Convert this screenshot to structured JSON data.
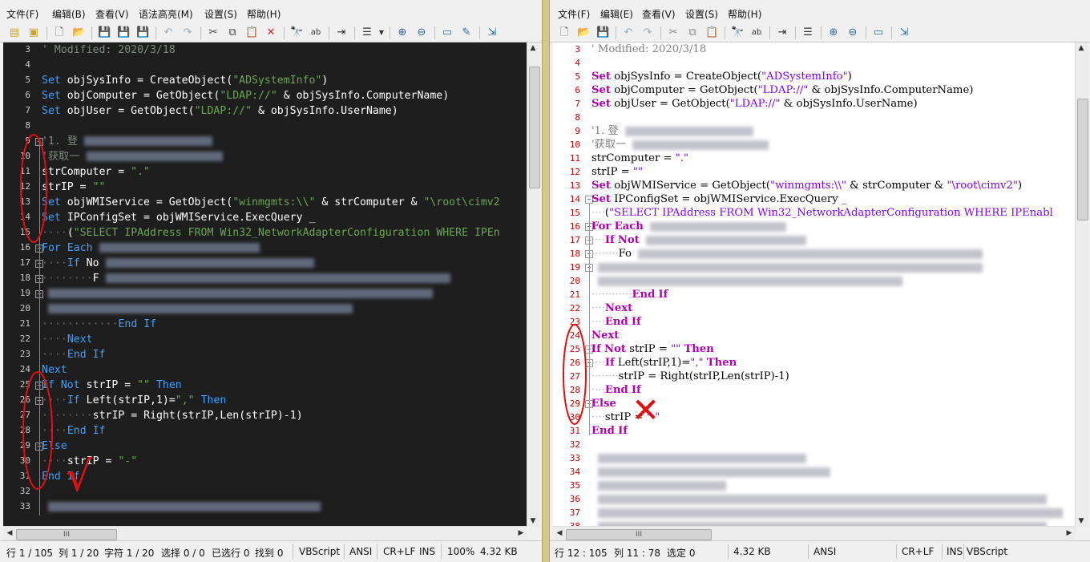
{
  "left": {
    "menu": [
      "文件(F)",
      "编辑(B)",
      "查看(V)",
      "语法高亮(M)",
      "设置(S)",
      "帮助(H)"
    ],
    "lines": [
      {
        "n": "3",
        "t": "' Modified: 2020/3/18"
      },
      {
        "n": "4",
        "t": ""
      },
      {
        "n": "5",
        "t": "Set objSysInfo = CreateObject(\"ADSystemInfo\")"
      },
      {
        "n": "6",
        "t": "Set objComputer = GetObject(\"LDAP://\" & objSysInfo.ComputerName)"
      },
      {
        "n": "7",
        "t": "Set objUser = GetObject(\"LDAP://\" & objSysInfo.UserName)"
      },
      {
        "n": "8",
        "t": ""
      },
      {
        "n": "9",
        "t": "'1. 登"
      },
      {
        "n": "10",
        "t": "'获取一"
      },
      {
        "n": "11",
        "t": "strComputer = \".\""
      },
      {
        "n": "12",
        "t": "strIP = \"\""
      },
      {
        "n": "13",
        "t": "Set objWMIService = GetObject(\"winmgmts:\\\\\" & strComputer & \"\\root\\cimv2"
      },
      {
        "n": "14",
        "t": "Set IPConfigSet = objWMIService.ExecQuery _"
      },
      {
        "n": "15",
        "t": "    (\"SELECT IPAddress FROM Win32_NetworkAdapterConfiguration WHERE IPEn"
      },
      {
        "n": "16",
        "t": "For Each"
      },
      {
        "n": "17",
        "t": "    If No"
      },
      {
        "n": "18",
        "t": "        F"
      },
      {
        "n": "19",
        "t": ""
      },
      {
        "n": "20",
        "t": ""
      },
      {
        "n": "21",
        "t": "            End If"
      },
      {
        "n": "22",
        "t": "    Next"
      },
      {
        "n": "23",
        "t": "    End If"
      },
      {
        "n": "24",
        "t": "Next"
      },
      {
        "n": "25",
        "t": "If Not strIP = \"\" Then"
      },
      {
        "n": "26",
        "t": "    If Left(strIP,1)=\",\" Then"
      },
      {
        "n": "27",
        "t": "        strIP = Right(strIP,Len(strIP)-1)"
      },
      {
        "n": "28",
        "t": "    End If"
      },
      {
        "n": "29",
        "t": "Else"
      },
      {
        "n": "30",
        "t": "    strIP = \"-\""
      },
      {
        "n": "31",
        "t": "End If"
      },
      {
        "n": "32",
        "t": ""
      },
      {
        "n": "33",
        "t": ""
      }
    ],
    "status": [
      "行 1 / 105",
      "列 1 / 20",
      "字符 1 / 20",
      "选择 0 / 0",
      "已选行 0",
      "找到 0",
      "VBScript",
      "ANSI",
      "CR+LF",
      "INS",
      "100%",
      "4.32 KB"
    ],
    "annotation": "√"
  },
  "right": {
    "menu": [
      "文件(F)",
      "编辑(E)",
      "查看(V)",
      "设置(S)",
      "帮助(H)"
    ],
    "lines": [
      {
        "n": "3",
        "t": "' Modified: 2020/3/18"
      },
      {
        "n": "4",
        "t": ""
      },
      {
        "n": "5",
        "t": "Set objSysInfo = CreateObject(\"ADSystemInfo\")"
      },
      {
        "n": "6",
        "t": "Set objComputer = GetObject(\"LDAP://\" & objSysInfo.ComputerName)"
      },
      {
        "n": "7",
        "t": "Set objUser = GetObject(\"LDAP://\" & objSysInfo.UserName)"
      },
      {
        "n": "8",
        "t": ""
      },
      {
        "n": "9",
        "t": "'1. 登"
      },
      {
        "n": "10",
        "t": "'获取一"
      },
      {
        "n": "11",
        "t": "strComputer = \".\""
      },
      {
        "n": "12",
        "t": "strIP = \"\""
      },
      {
        "n": "13",
        "t": "Set objWMIService = GetObject(\"winmgmts:\\\\\" & strComputer & \"\\root\\cimv2\")"
      },
      {
        "n": "14",
        "t": "Set IPConfigSet = objWMIService.ExecQuery _"
      },
      {
        "n": "15",
        "t": "    (\"SELECT IPAddress FROM Win32_NetworkAdapterConfiguration WHERE IPEnabl"
      },
      {
        "n": "16",
        "t": "For Each"
      },
      {
        "n": "17",
        "t": "    If Not"
      },
      {
        "n": "18",
        "t": "        Fo"
      },
      {
        "n": "19",
        "t": ""
      },
      {
        "n": "20",
        "t": ""
      },
      {
        "n": "21",
        "t": "            End If"
      },
      {
        "n": "22",
        "t": "    Next"
      },
      {
        "n": "23",
        "t": "    End If"
      },
      {
        "n": "24",
        "t": "Next"
      },
      {
        "n": "25",
        "t": "If Not strIP = \"\" Then"
      },
      {
        "n": "26",
        "t": "    If Left(strIP,1)=\",\" Then"
      },
      {
        "n": "27",
        "t": "        strIP = Right(strIP,Len(strIP)-1)"
      },
      {
        "n": "28",
        "t": "    End If"
      },
      {
        "n": "29",
        "t": "Else"
      },
      {
        "n": "30",
        "t": "    strIP = \"-\""
      },
      {
        "n": "31",
        "t": "End If"
      },
      {
        "n": "32",
        "t": ""
      },
      {
        "n": "33",
        "t": ""
      },
      {
        "n": "34",
        "t": ""
      },
      {
        "n": "35",
        "t": ""
      },
      {
        "n": "36",
        "t": ""
      },
      {
        "n": "37",
        "t": ""
      },
      {
        "n": "38",
        "t": ""
      }
    ],
    "status": [
      "行 12 : 105",
      "列 11 : 78",
      "选定 0",
      "4.32 KB",
      "ANSI",
      "CR+LF",
      "INS",
      "VBScript"
    ],
    "annotation": "✕"
  },
  "colors": {
    "annotation": "#e01010",
    "left_bg": "#1e1e1e",
    "right_bg": "#ffffff"
  }
}
